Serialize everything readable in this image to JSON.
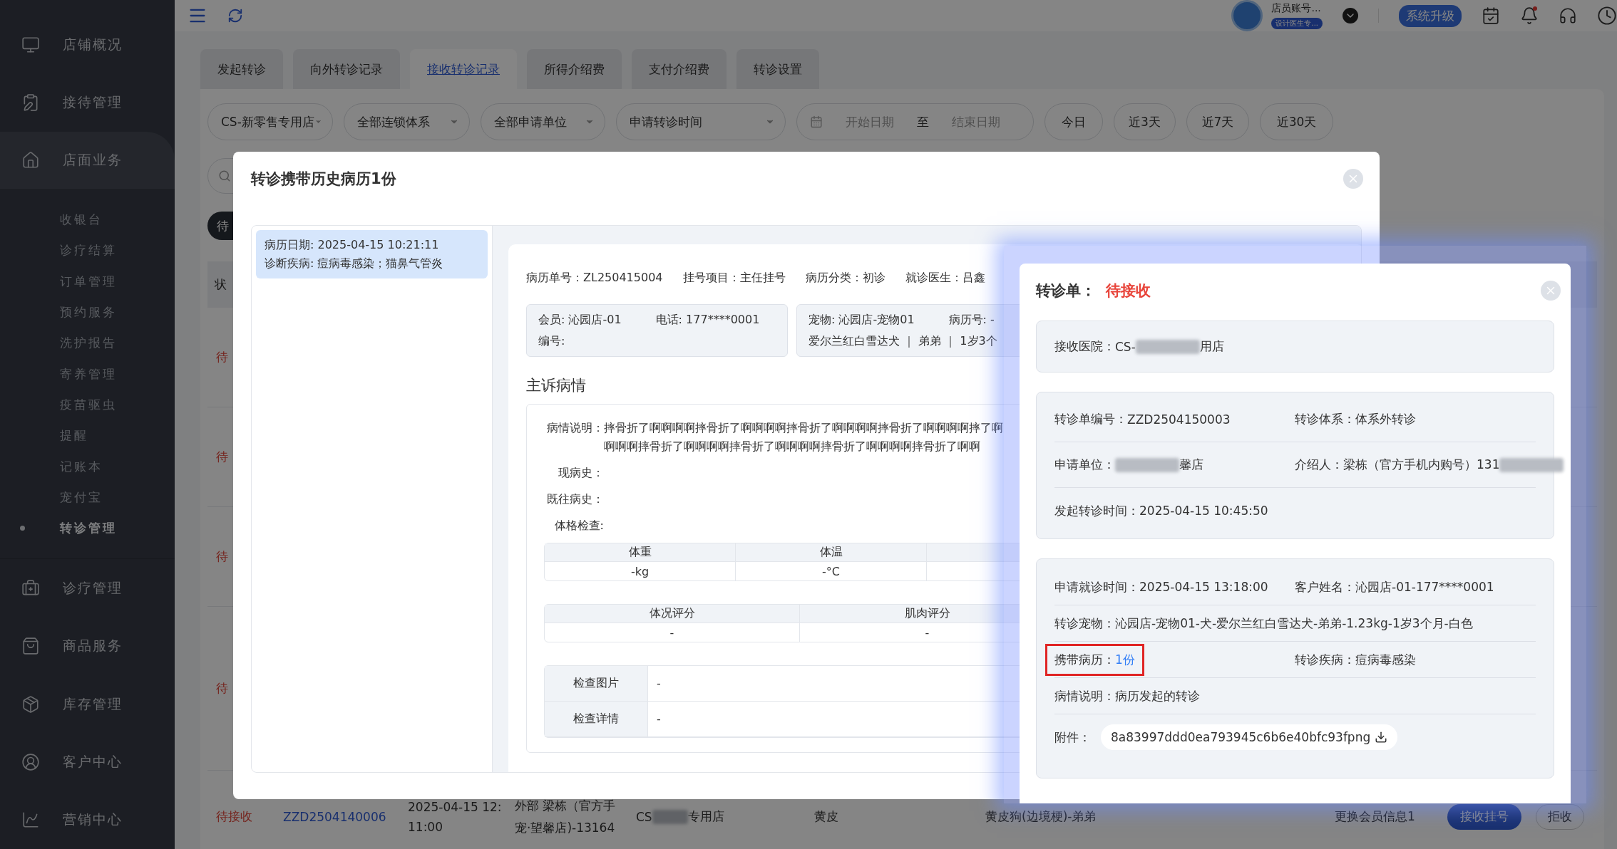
{
  "topbar": {
    "account_name": "店员账号...",
    "account_role": "设计医生专...",
    "notification_dot": true,
    "upgrade_button": "系统升级"
  },
  "sidebar": {
    "items": [
      {
        "label": "店铺概况",
        "selected": false,
        "expanded": false
      },
      {
        "label": "接待管理",
        "selected": false,
        "expanded": false
      },
      {
        "label": "店面业务",
        "selected": false,
        "expanded": true,
        "children": [
          {
            "label": "收银台",
            "selected": false
          },
          {
            "label": "诊疗结算",
            "selected": false
          },
          {
            "label": "订单管理",
            "selected": false
          },
          {
            "label": "预约服务",
            "selected": false
          },
          {
            "label": "洗护报告",
            "selected": false
          },
          {
            "label": "寄养管理",
            "selected": false
          },
          {
            "label": "疫苗驱虫",
            "selected": false
          },
          {
            "label": "提醒",
            "selected": false
          },
          {
            "label": "记账本",
            "selected": false
          },
          {
            "label": "宠付宝",
            "selected": false
          },
          {
            "label": "转诊管理",
            "selected": true
          }
        ]
      },
      {
        "label": "诊疗管理",
        "selected": false,
        "expanded": false
      },
      {
        "label": "商品服务",
        "selected": false,
        "expanded": false
      },
      {
        "label": "库存管理",
        "selected": false,
        "expanded": false
      },
      {
        "label": "客户中心",
        "selected": false,
        "expanded": false
      },
      {
        "label": "营销中心",
        "selected": false,
        "expanded": false
      }
    ]
  },
  "tabs": [
    {
      "label": "发起转诊",
      "selected": false
    },
    {
      "label": "向外转诊记录",
      "selected": false
    },
    {
      "label": "接收转诊记录",
      "selected": true
    },
    {
      "label": "所得介绍费",
      "selected": false
    },
    {
      "label": "支付介绍费",
      "selected": false
    },
    {
      "label": "转诊设置",
      "selected": false
    }
  ],
  "filters": {
    "selects": [
      "CS-新零售专用店",
      "全部连锁体系",
      "全部申请单位",
      "申请转诊时间"
    ],
    "date_range": {
      "start_placeholder": "开始日期",
      "separator": "至",
      "end_placeholder": "结束日期"
    },
    "quick_ranges": [
      "今日",
      "近3天",
      "近7天",
      "近30天"
    ]
  },
  "status_filter": {
    "label": "待"
  },
  "table": {
    "column_1": "状",
    "rows": [
      {
        "kind": "partial",
        "status": "待"
      },
      {
        "kind": "partial",
        "status": "待"
      },
      {
        "kind": "partial",
        "status": "待"
      },
      {
        "kind": "partial",
        "status": "待"
      },
      {
        "kind": "full",
        "status": "待接收",
        "order_no": "ZZD2504140006",
        "time_lines": [
          "2025-04-15 12:",
          "11:00"
        ],
        "applicant_lines": [
          "外部 梁栋（官方手",
          "宠·望馨店)-13164"
        ],
        "hospital_start": "CS",
        "hospital_end": "专用店",
        "column_6": "黄皮",
        "pet": "黄皮狗(边境梗)-弟弟",
        "note": "更换会员信息1",
        "actions": [
          "接收挂号",
          "拒收"
        ]
      }
    ]
  },
  "history_modal": {
    "title": "转诊携带历史病历1份",
    "records": [
      {
        "date": "病历日期: 2025-04-15 10:21:11",
        "diagnosis": "诊断疾病: 痘病毒感染；猫鼻气管炎",
        "selected": true
      }
    ],
    "meta": [
      "病历单号：ZL250415004",
      "挂号项目：主任挂号",
      "病历分类：初诊",
      "就诊医生：吕鑫"
    ],
    "member_card": [
      [
        "会员: 沁园店-01",
        "电话: 177****0001"
      ],
      [
        "编号:"
      ]
    ],
    "pet_card": [
      [
        "宠物: 沁园店-宠物01",
        "病历号: -"
      ],
      [
        "爱尔兰红白雪达犬 ｜ 弟弟 ｜ 1岁3个"
      ]
    ],
    "section_title": "主诉病情",
    "fields": [
      {
        "label": "病情说明：",
        "value": "摔骨折了啊啊啊啊摔骨折了啊啊啊啊摔骨折了啊啊啊啊摔骨折了啊啊啊啊摔了啊啊啊啊摔骨折了啊啊啊啊摔骨折了啊啊啊啊摔骨折了啊啊啊啊摔骨折了啊啊"
      },
      {
        "label": "现病史："
      },
      {
        "label": "既往病史："
      },
      {
        "label": "体格检查:"
      }
    ],
    "vitals_table": {
      "columns": [
        "体重",
        "体温"
      ],
      "values": [
        "-kg",
        "-°C"
      ]
    },
    "score_table": {
      "columns": [
        "体况评分",
        "肌肉评分"
      ],
      "values": [
        "-",
        "-"
      ]
    },
    "exam_rows": [
      {
        "label": "检查图片",
        "value": "-"
      },
      {
        "label": "检查详情",
        "value": "-"
      }
    ]
  },
  "referral_modal": {
    "title": "转诊单：",
    "status": "待接收",
    "hospital": {
      "label": "接收医院：",
      "highlighted": false,
      "parts": [
        {
          "kind": "text",
          "text": "CS-"
        },
        {
          "kind": "blur"
        },
        {
          "kind": "text",
          "text": "用店"
        }
      ]
    },
    "info_rows": [
      [
        {
          "label": "转诊单编号：",
          "highlighted": false,
          "parts": [
            {
              "kind": "text",
              "text": "ZZD2504150003"
            }
          ]
        },
        {
          "label": "转诊体系：",
          "highlighted": false,
          "parts": [
            {
              "kind": "text",
              "text": "体系外转诊"
            }
          ]
        }
      ],
      [
        {
          "label": "申请单位：",
          "highlighted": false,
          "parts": [
            {
              "kind": "blur"
            },
            {
              "kind": "text",
              "text": "馨店"
            }
          ]
        },
        {
          "label": "介绍人：",
          "highlighted": false,
          "parts": [
            {
              "kind": "text",
              "text": "梁栋（官方手机内购号）131"
            },
            {
              "kind": "blur"
            }
          ]
        }
      ],
      [
        {
          "label": "发起转诊时间：",
          "highlighted": false,
          "parts": [
            {
              "kind": "text",
              "text": "2025-04-15 10:45:50"
            }
          ]
        }
      ]
    ],
    "visit_rows": [
      [
        {
          "label": "申请就诊时间：",
          "highlighted": false,
          "parts": [
            {
              "kind": "text",
              "text": "2025-04-15 13:18:00"
            }
          ]
        },
        {
          "label": "客户姓名：",
          "highlighted": false,
          "parts": [
            {
              "kind": "text",
              "text": "沁园店-01-177****0001"
            }
          ]
        }
      ],
      [
        {
          "label": "转诊宠物：",
          "highlighted": false,
          "parts": [
            {
              "kind": "text",
              "text": "沁园店-宠物01-犬-爱尔兰红白雪达犬-弟弟-1.23kg-1岁3个月-白色"
            }
          ]
        }
      ],
      [
        {
          "label": "携带病历：",
          "highlighted": true,
          "parts": [
            {
              "kind": "link",
              "text": "1份"
            }
          ]
        },
        {
          "label": "转诊疾病：",
          "highlighted": false,
          "parts": [
            {
              "kind": "text",
              "text": "痘病毒感染"
            }
          ]
        }
      ],
      [
        {
          "label": "病情说明：",
          "highlighted": false,
          "parts": [
            {
              "kind": "text",
              "text": "病历发起的转诊"
            }
          ]
        }
      ]
    ],
    "attachment": {
      "label": "附件：",
      "file": "8a83997ddd0ea793945c6b6e40bfc93fpng"
    }
  }
}
